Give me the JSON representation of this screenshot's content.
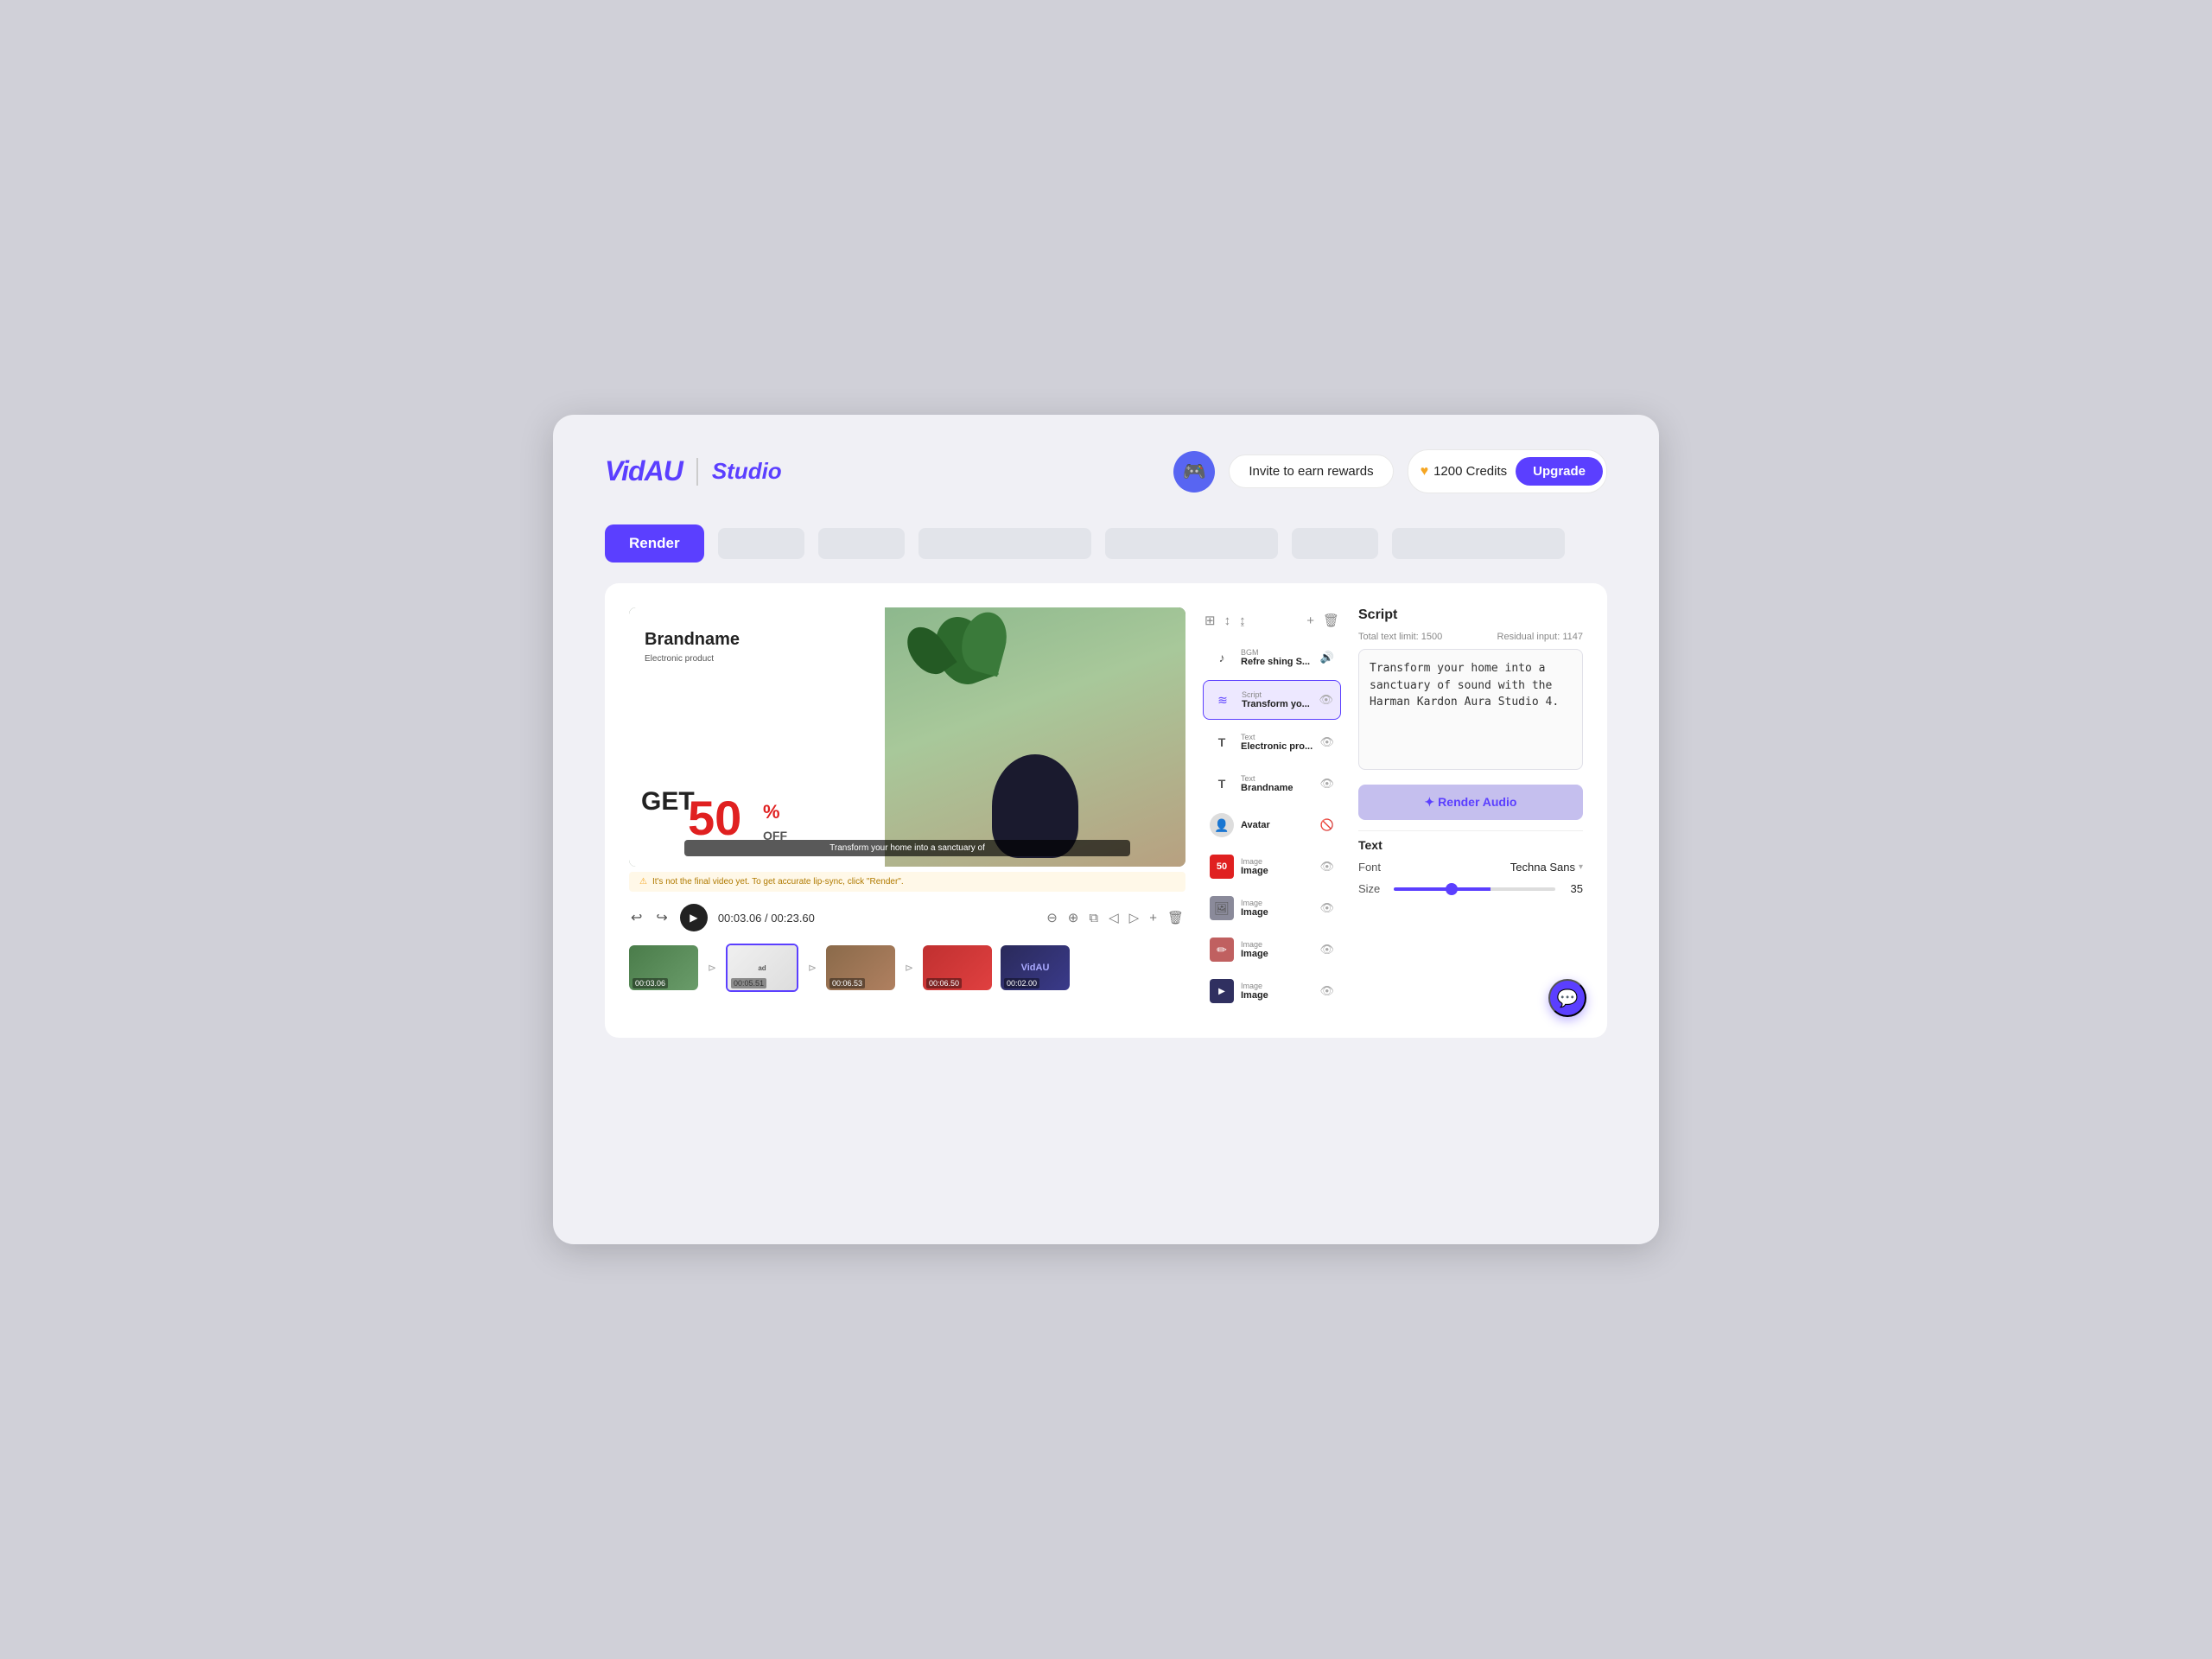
{
  "app": {
    "logo": "VidAU",
    "studio": "Studio"
  },
  "header": {
    "discord_icon": "discord",
    "invite_label": "Invite to earn rewards",
    "credits_icon": "♥",
    "credits_count": "1200 Credits",
    "upgrade_label": "Upgrade"
  },
  "toolbar": {
    "render_label": "Render",
    "placeholders": [
      "",
      "",
      "",
      "",
      "",
      ""
    ]
  },
  "video": {
    "ad": {
      "brandname": "Brandname",
      "subtitle": "Electronic product",
      "get_text": "GET",
      "discount": "50",
      "percent": "%",
      "off": "OFF"
    },
    "subtitle_text": "Transform your home into a sanctuary of",
    "warning_text": "It's not the final video yet. To get accurate lip-sync, click \"Render\".",
    "warning_icon": "⚠"
  },
  "playback": {
    "undo_icon": "↩",
    "redo_icon": "↪",
    "play_icon": "▶",
    "current_time": "00:03.06",
    "total_time": "00:23.60",
    "zoom_out_icon": "⊖",
    "zoom_in_icon": "⊕",
    "split_icon": "⧉",
    "trim_left_icon": "◁",
    "trim_right_icon": "▷",
    "add_icon": "+",
    "delete_icon": "🗑"
  },
  "timeline": {
    "clips": [
      {
        "id": 1,
        "time": "00:03.06",
        "color": "clip-green",
        "active": false
      },
      {
        "id": 2,
        "time": "00:05.51",
        "color": "clip-white-ad",
        "active": true
      },
      {
        "id": 3,
        "time": "00:06.53",
        "color": "clip-shelf",
        "active": false
      },
      {
        "id": 4,
        "time": "00:06.50",
        "color": "clip-red",
        "active": false
      },
      {
        "id": 5,
        "time": "00:02.00",
        "color": "clip-vidau",
        "active": false
      }
    ]
  },
  "layers": {
    "tools": [
      "⊞",
      "↕",
      "↨",
      "+",
      "🗑"
    ],
    "items": [
      {
        "id": "bgm",
        "type": "BGM",
        "name": "Refre shing S...",
        "icon": "♪",
        "eye": "👁",
        "active": false
      },
      {
        "id": "script",
        "type": "Script",
        "name": "Transform yo...",
        "icon": "≋",
        "eye": "👁",
        "active": true
      },
      {
        "id": "text1",
        "type": "Text",
        "name": "Electronic pro...",
        "icon": "T",
        "eye": "👁",
        "active": false
      },
      {
        "id": "text2",
        "type": "Text",
        "name": "Brandname",
        "icon": "T",
        "eye": "👁",
        "active": false
      },
      {
        "id": "avatar",
        "type": "Avatar",
        "name": "Avatar",
        "icon": "👤",
        "eye": "🚫",
        "active": false
      },
      {
        "id": "image1",
        "type": "Image",
        "name": "Image",
        "icon": "50",
        "eye": "👁",
        "active": false
      },
      {
        "id": "image2",
        "type": "Image",
        "name": "Image",
        "icon": "🖼",
        "eye": "👁",
        "active": false
      },
      {
        "id": "image3",
        "type": "Image",
        "name": "Image",
        "icon": "✏",
        "eye": "👁",
        "active": false
      },
      {
        "id": "image4",
        "type": "Image",
        "name": "Image",
        "icon": "🖼",
        "eye": "👁",
        "active": false
      }
    ]
  },
  "script_panel": {
    "title": "Script",
    "total_limit_label": "Total text limit: 1500",
    "residual_label": "Residual input: 1147",
    "script_content": "Transform your home into a sanctuary of sound with the Harman Kardon Aura Studio 4.",
    "render_audio_label": "✦ Render Audio"
  },
  "text_panel": {
    "title": "Text",
    "font_label": "Font",
    "font_value": "Techna Sans",
    "size_label": "Size",
    "size_value": "35",
    "size_min": 1,
    "size_max": 100,
    "size_percent": 60
  }
}
